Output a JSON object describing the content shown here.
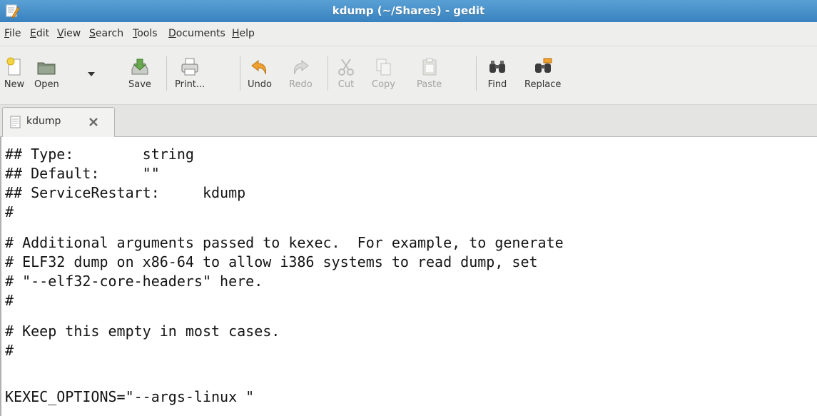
{
  "window": {
    "title": "kdump (~/Shares) - gedit"
  },
  "menu": {
    "items": [
      {
        "mnemonic": "F",
        "rest": "ile"
      },
      {
        "mnemonic": "E",
        "rest": "dit"
      },
      {
        "mnemonic": "V",
        "rest": "iew"
      },
      {
        "mnemonic": "S",
        "rest": "earch"
      },
      {
        "mnemonic": "T",
        "rest": "ools"
      },
      {
        "mnemonic": "D",
        "rest": "ocuments"
      },
      {
        "mnemonic": "H",
        "rest": "elp"
      }
    ]
  },
  "toolbar": {
    "new": "New",
    "open": "Open",
    "save": "Save",
    "print": "Print...",
    "undo": "Undo",
    "redo": "Redo",
    "cut": "Cut",
    "copy": "Copy",
    "paste": "Paste",
    "find": "Find",
    "replace": "Replace"
  },
  "tab": {
    "label": "kdump"
  },
  "editor": {
    "lines": [
      "## Type:        string",
      "## Default:     \"\"",
      "## ServiceRestart:     kdump",
      "#",
      "# Additional arguments passed to kexec.  For example, to generate",
      "# ELF32 dump on x86-64 to allow i386 systems to read dump, set",
      "# \"--elf32-core-headers\" here.",
      "#",
      "# Keep this empty in most cases.",
      "#",
      "",
      "KEXEC_OPTIONS=\"--args-linux \""
    ]
  },
  "colors": {
    "titlebar": "#3a82bf",
    "accent_orange": "#f0a030",
    "menu_bg": "#eeeeec"
  }
}
